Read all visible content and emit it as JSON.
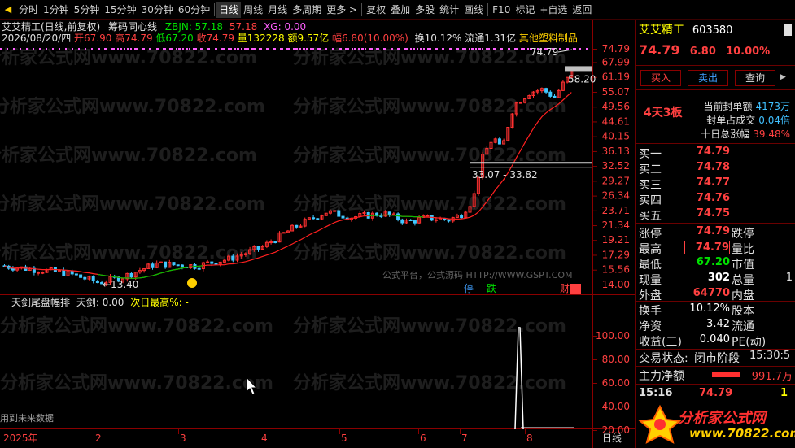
{
  "toolbar": {
    "items": [
      "分时",
      "1分钟",
      "5分钟",
      "15分钟",
      "30分钟",
      "60分钟",
      "日线",
      "周线",
      "月线",
      "多周期",
      "更多 >",
      "复权",
      "叠加",
      "多股",
      "统计",
      "画线",
      "F10",
      "标记",
      "+自选",
      "返回"
    ],
    "active": "日线"
  },
  "info": {
    "stock_title": "艾艾精工(日线,前复权)",
    "chip_label": "筹码同心线",
    "zbjn_label": "ZBJN: 57.18",
    "zbjn_val2": "57.18",
    "xg_label": "XG: 0.00",
    "date": "2026/08/20/四",
    "open": "开67.90",
    "high": "高74.79",
    "low": "低67.20",
    "close": "收74.79",
    "vol": "量132228",
    "amt": "额9.57亿",
    "range": "幅6.80(10.00%)",
    "turnover": "换10.12%",
    "float": "流通1.31亿",
    "sector": "其他塑料制品"
  },
  "indicator": {
    "title": "天剑尾盘幅排",
    "tianjian": "天剑: 0.00",
    "nextday": "次日最高%: -",
    "future_note": "用到未来数据"
  },
  "watermark": "分析家公式网www.70822.com",
  "chart_data": {
    "type": "candlestick",
    "price_axis": [
      "74.79",
      "67.99",
      "61.19",
      "55.07",
      "49.56",
      "44.61",
      "40.15",
      "36.13",
      "32.52",
      "29.27",
      "26.34",
      "23.71",
      "21.34",
      "19.21",
      "17.29",
      "15.56",
      "14.00"
    ],
    "indicator_axis": [
      "100.00",
      "80.00",
      "60.00",
      "40.00",
      "20.00"
    ],
    "x_labels": [
      "2025年",
      "2",
      "3",
      "4",
      "5",
      "6",
      "7",
      "8"
    ],
    "annotations": {
      "high_marker": "74.79",
      "support_label": "58.20",
      "low_marker": "13.40",
      "gap_label": "33.07 - 33.82",
      "ting_label": "停",
      "die_label": "跌",
      "caibao_label": "财",
      "formula_site": "公式平台，公式源码 HTTP://WWW.GSPT.COM"
    },
    "colors": {
      "up": "#ff3030",
      "down": "#40c8ff",
      "ma": "#ff2020",
      "ma_green": "#00c000"
    }
  },
  "quote": {
    "name": "艾艾精工",
    "code": "603580",
    "price": "74.79",
    "change": "6.80",
    "pct": "10.00%",
    "buy_label": "买入",
    "sell_label": "卖出",
    "query_label": "查询",
    "streak": "4天3板",
    "stats": [
      {
        "k": "当前封单额",
        "v": "4173万"
      },
      {
        "k": "封单占成交",
        "v": "0.04倍"
      },
      {
        "k": "十日总涨幅",
        "v": "39.48%"
      }
    ],
    "bids": [
      {
        "label": "买一",
        "price": "74.79"
      },
      {
        "label": "买二",
        "price": "74.78"
      },
      {
        "label": "买三",
        "price": "74.77"
      },
      {
        "label": "买四",
        "price": "74.76"
      },
      {
        "label": "买五",
        "price": "74.75"
      }
    ],
    "detail": [
      {
        "l1": "涨停",
        "v1": "74.79",
        "l2": "跌停",
        "v2": ""
      },
      {
        "l1": "最高",
        "v1": "74.79",
        "l2": "量比",
        "v2": ""
      },
      {
        "l1": "最低",
        "v1": "67.20",
        "l2": "市值",
        "v2": ""
      },
      {
        "l1": "现量",
        "v1": "302",
        "l2": "总量",
        "v2": "1"
      },
      {
        "l1": "外盘",
        "v1": "64770",
        "l2": "内盘",
        "v2": ""
      }
    ],
    "fund": [
      {
        "l1": "换手",
        "v1": "10.12%",
        "l2": "股本"
      },
      {
        "l1": "净资",
        "v1": "3.42",
        "l2": "流通"
      },
      {
        "l1": "收益(三)",
        "v1": "0.040",
        "l2": "PE(动)"
      }
    ],
    "status_label": "交易状态:",
    "status_value": "闭市阶段",
    "status_time": "15:30:5",
    "zl_label": "主力净额",
    "zl_value": "991.7万",
    "tick_time": "15:16",
    "tick_price": "74.79",
    "tick_vol": "1",
    "logo_text": "分析家公式网",
    "logo_url": "www.70822.com",
    "bottom_tab": "日线"
  }
}
